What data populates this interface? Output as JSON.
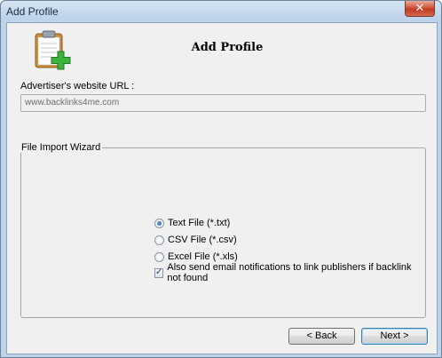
{
  "window": {
    "title": "Add Profile",
    "close_glyph": "✕"
  },
  "header": {
    "icon": "clipboard-add-icon",
    "title": "Add Profile"
  },
  "url": {
    "label": "Advertiser's website URL :",
    "value": "www.backlinks4me.com"
  },
  "wizard": {
    "legend": "File Import Wizard",
    "options": [
      {
        "label": "Text File (*.txt)",
        "checked": true
      },
      {
        "label": "CSV File (*.csv)",
        "checked": false
      },
      {
        "label": "Excel File (*.xls)",
        "checked": false
      }
    ],
    "notify": {
      "label": "Also send email notifications to link publishers if backlink not found",
      "checked": true
    }
  },
  "buttons": {
    "back": "< Back",
    "next": "Next >"
  },
  "colors": {
    "frame": "#bcd3ea",
    "client": "#f0f0f0",
    "close": "#c13b20",
    "plus": "#3cb33c"
  }
}
